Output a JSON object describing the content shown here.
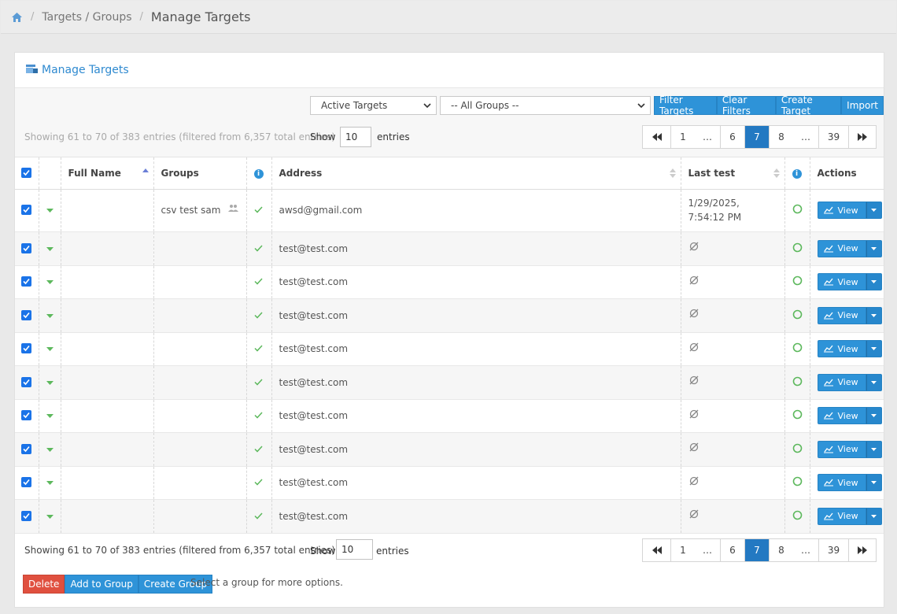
{
  "breadcrumb": {
    "items": [
      "Targets / Groups"
    ],
    "current": "Manage Targets"
  },
  "panel": {
    "title": "Manage Targets"
  },
  "filters": {
    "status_select": "Active Targets",
    "group_select": "-- All Groups --",
    "buttons": [
      "Filter Targets",
      "Clear Filters",
      "Create Target",
      "Import"
    ]
  },
  "info": {
    "top": "Showing 61 to 70 of 383 entries (filtered from 6,357 total entries)",
    "bottom": "Showing 61 to 70 of 383 entries (filtered from 6,357 total entries)",
    "show_label": "Show",
    "entries_label": "entries",
    "page_length": "10"
  },
  "pagination": {
    "pages": [
      "1",
      "…",
      "6",
      "7",
      "8",
      "…",
      "39"
    ],
    "active": "7"
  },
  "table": {
    "columns": {
      "full_name": "Full Name",
      "groups": "Groups",
      "address": "Address",
      "last_test": "Last test",
      "actions": "Actions"
    },
    "view_label": "View",
    "rows": [
      {
        "full_name": "",
        "group": "csv test sam",
        "address": "awsd@gmail.com",
        "last_test": "1/29/2025, 7:54:12 PM"
      },
      {
        "full_name": "",
        "group": "",
        "address": "test@test.com",
        "last_test": ""
      },
      {
        "full_name": "",
        "group": "",
        "address": "test@test.com",
        "last_test": ""
      },
      {
        "full_name": "",
        "group": "",
        "address": "test@test.com",
        "last_test": ""
      },
      {
        "full_name": "",
        "group": "",
        "address": "test@test.com",
        "last_test": ""
      },
      {
        "full_name": "",
        "group": "",
        "address": "test@test.com",
        "last_test": ""
      },
      {
        "full_name": "",
        "group": "",
        "address": "test@test.com",
        "last_test": ""
      },
      {
        "full_name": "",
        "group": "",
        "address": "test@test.com",
        "last_test": ""
      },
      {
        "full_name": "",
        "group": "",
        "address": "test@test.com",
        "last_test": ""
      },
      {
        "full_name": "",
        "group": "",
        "address": "test@test.com",
        "last_test": ""
      }
    ]
  },
  "bulk": {
    "delete": "Delete",
    "add_to_group": "Add to Group",
    "create_group": "Create Group",
    "help": "Select a group for more options."
  },
  "colors": {
    "accent": "#2e93d8",
    "danger": "#e0503f",
    "success": "#5cb85c"
  }
}
